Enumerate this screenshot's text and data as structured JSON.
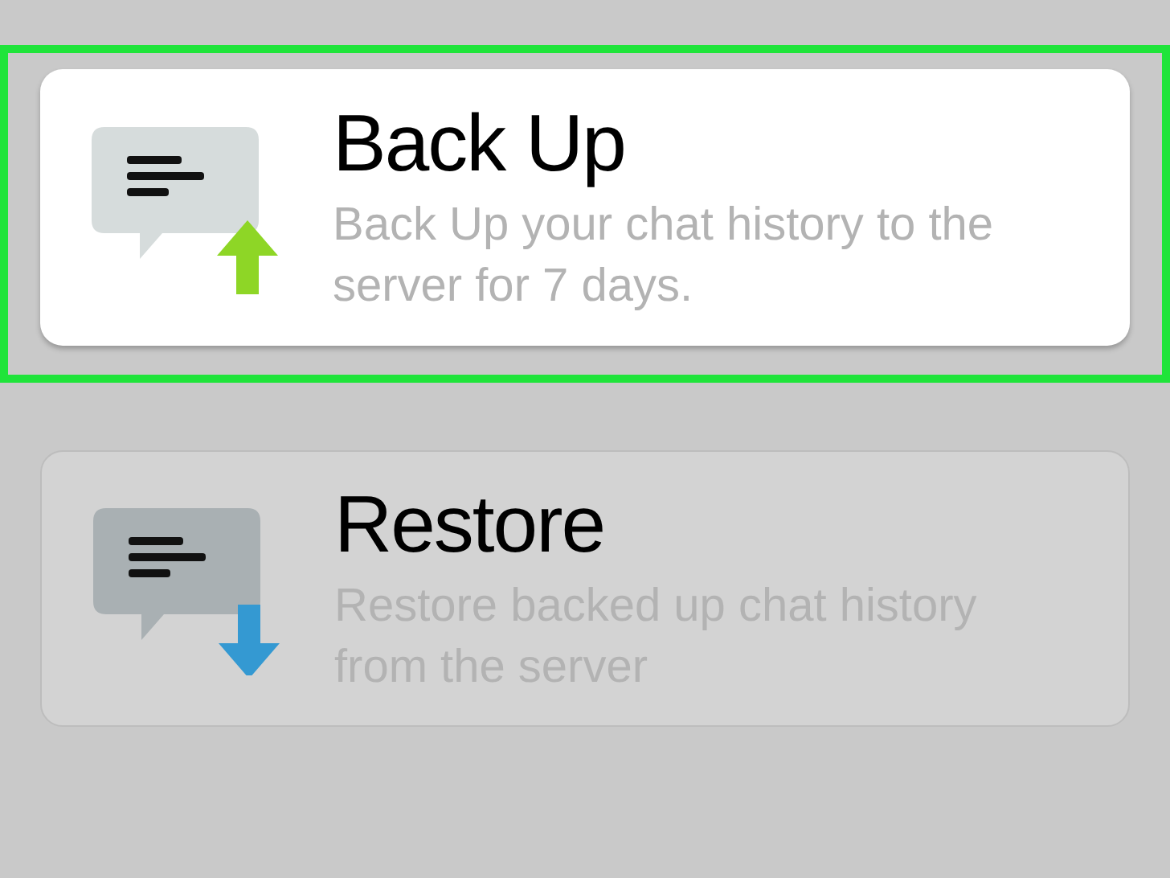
{
  "options": [
    {
      "kind": "backup",
      "title": "Back Up",
      "description": "Back Up your chat history to the server for 7 days.",
      "selected": true
    },
    {
      "kind": "restore",
      "title": "Restore",
      "description": "Restore backed up chat history from the server",
      "selected": false
    }
  ]
}
